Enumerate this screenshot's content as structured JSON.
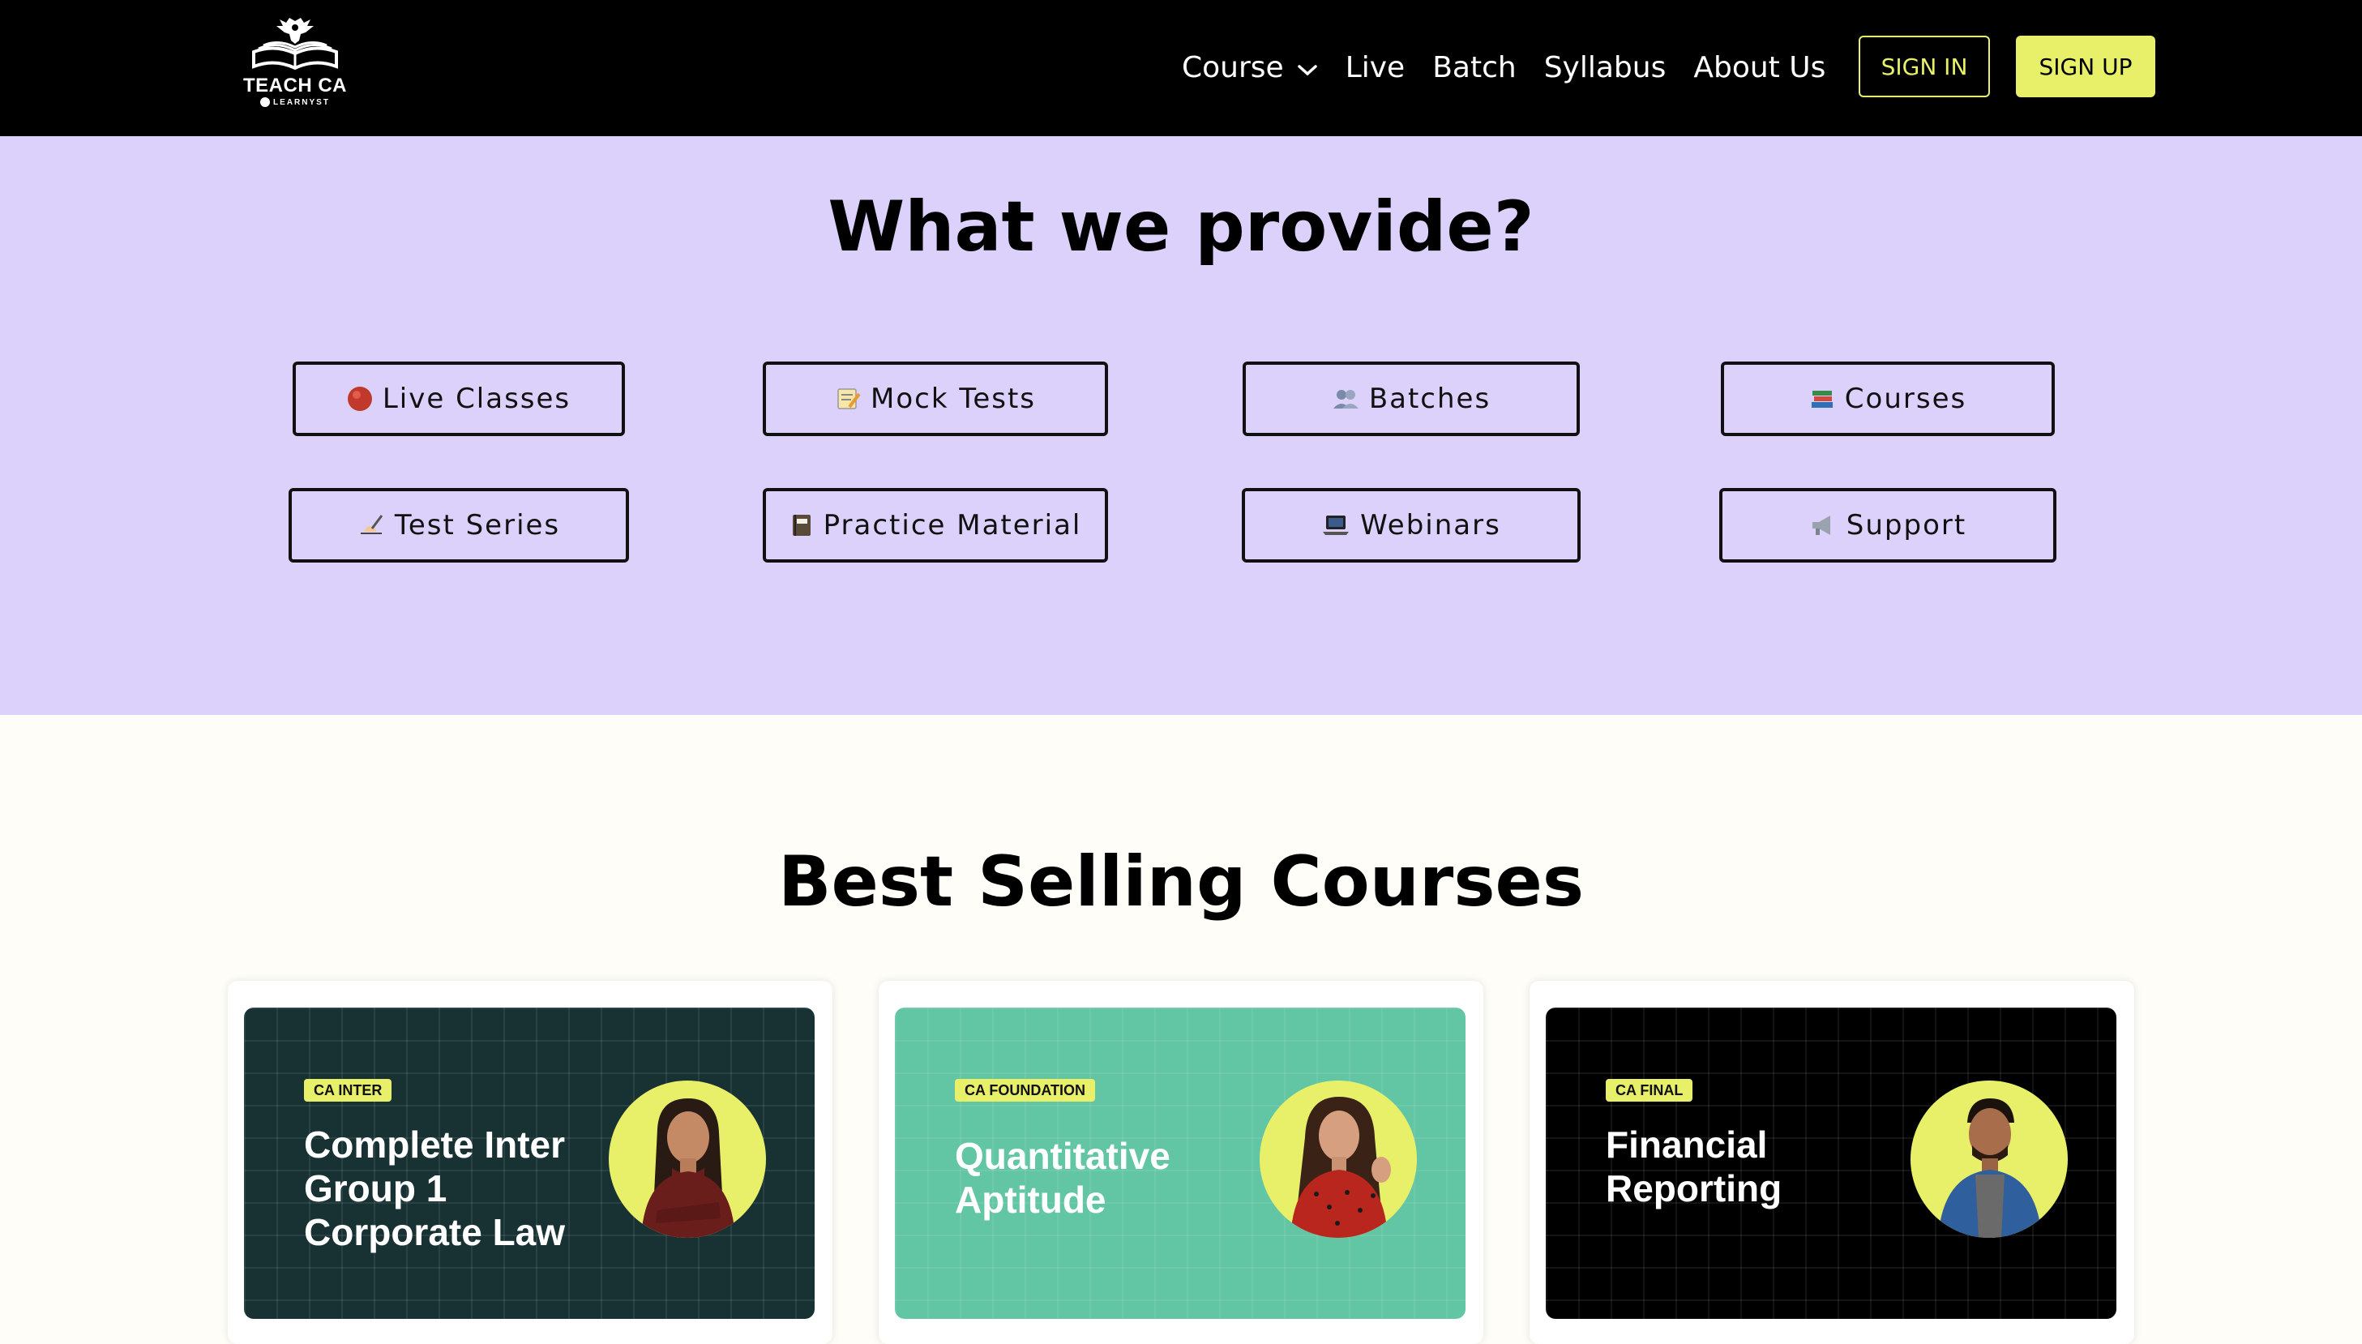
{
  "nav": {
    "logo_text": "TEACH CA",
    "logo_sub": "LEARNYST",
    "links": [
      "Course",
      "Live",
      "Batch",
      "Syllabus",
      "About Us"
    ],
    "sign_in": "SIGN IN",
    "sign_up": "SIGN UP"
  },
  "provide": {
    "title": "What we provide?",
    "items": [
      {
        "label": "Live Classes",
        "icon": "red-circle-icon"
      },
      {
        "label": "Mock Tests",
        "icon": "memo-icon"
      },
      {
        "label": "Batches",
        "icon": "people-icon"
      },
      {
        "label": "Courses",
        "icon": "books-icon"
      },
      {
        "label": "Test Series",
        "icon": "writing-hand-icon"
      },
      {
        "label": "Practice Material",
        "icon": "notebook-icon"
      },
      {
        "label": "Webinars",
        "icon": "laptop-icon"
      },
      {
        "label": "Support",
        "icon": "megaphone-icon"
      }
    ]
  },
  "best": {
    "title": "Best Selling Courses",
    "courses": [
      {
        "tag": "CA INTER",
        "title": "Complete Inter Group 1 Corporate Law",
        "bg": "#183234"
      },
      {
        "tag": "CA FOUNDATION",
        "title": "Quantitative Aptitude",
        "bg": "#62c6a4"
      },
      {
        "tag": "CA FINAL",
        "title": "Financial Reporting",
        "bg": "#000000"
      }
    ]
  },
  "colors": {
    "accent": "#e8f06a",
    "provide_bg": "#dcd1fb",
    "nav_bg": "#000000"
  }
}
